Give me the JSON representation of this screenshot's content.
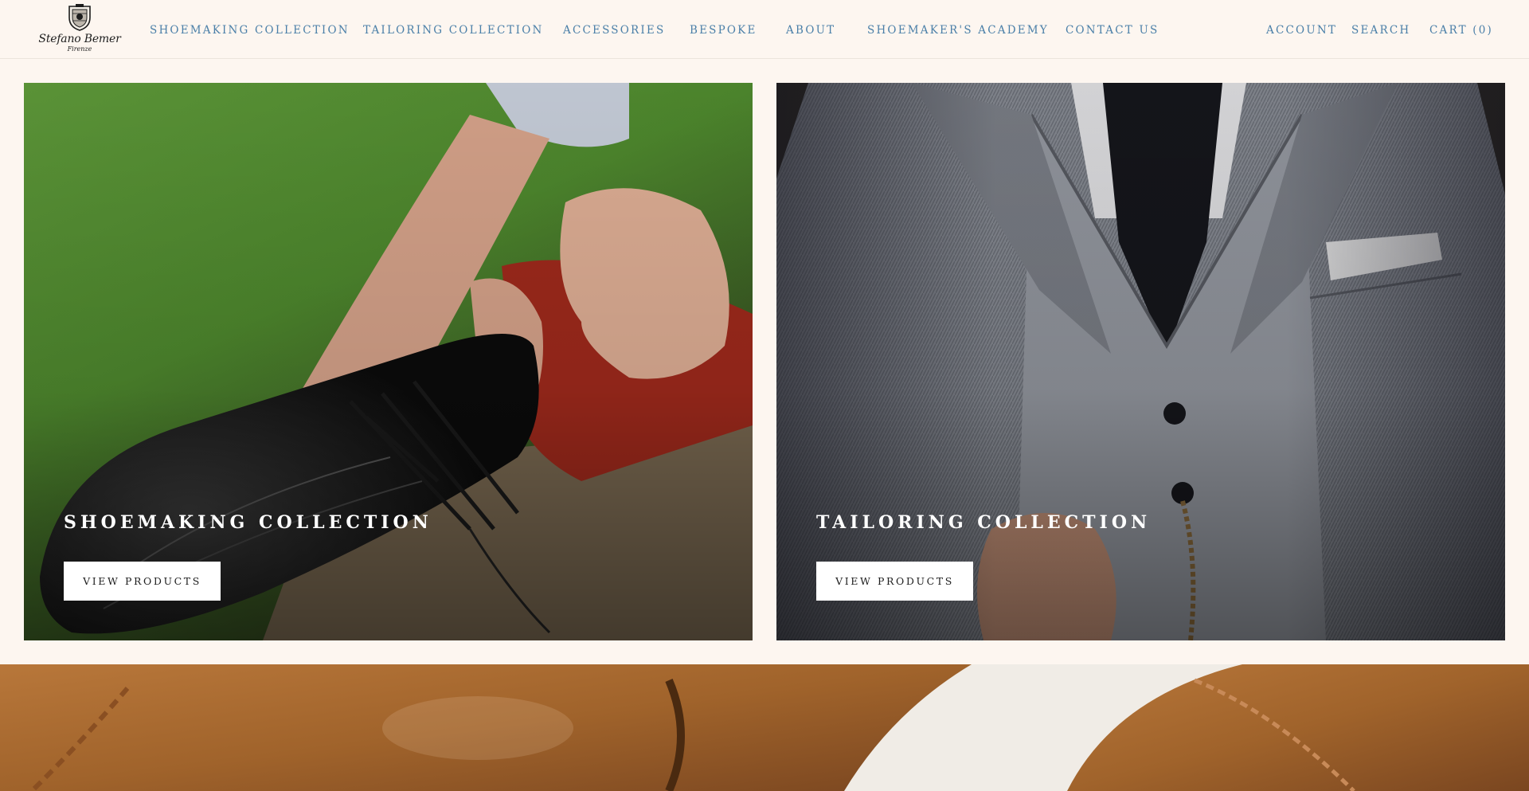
{
  "brand": {
    "name": "Stefano Bemer",
    "city": "Firenze",
    "logo_icon": "crest-icon"
  },
  "nav": {
    "items": [
      {
        "label": "SHOEMAKING COLLECTION"
      },
      {
        "label": "TAILORING COLLECTION"
      },
      {
        "label": "ACCESSORIES"
      },
      {
        "label": "BESPOKE"
      },
      {
        "label": "ABOUT"
      },
      {
        "label": "SHOEMAKER'S ACADEMY"
      },
      {
        "label": "CONTACT US"
      }
    ],
    "account_label": "ACCOUNT",
    "search_label": "SEARCH",
    "cart_label": "CART (0)"
  },
  "collections": [
    {
      "title": "SHOEMAKING COLLECTION",
      "button_label": "VIEW PRODUCTS",
      "image": "shoe-lacing-photo"
    },
    {
      "title": "TAILORING COLLECTION",
      "button_label": "VIEW PRODUCTS",
      "image": "tailored-suit-photo"
    }
  ],
  "banner": {
    "image": "leather-detail-photo"
  },
  "colors": {
    "background": "#fdf6f0",
    "nav_link": "#4a7fa8",
    "button_bg": "#ffffff",
    "title_text": "#ffffff"
  }
}
